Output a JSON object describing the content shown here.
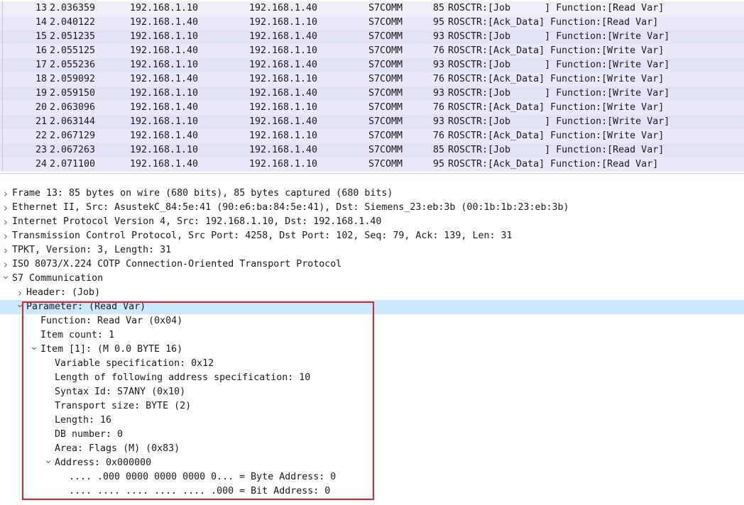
{
  "packet_list": {
    "rows": [
      {
        "no": "13",
        "time": "2.036359",
        "source": "192.168.1.10",
        "destination": "192.168.1.40",
        "protocol": "S7COMM",
        "length": "85",
        "info": "ROSCTR:[Job      ] Function:[Read Var]"
      },
      {
        "no": "14",
        "time": "2.040122",
        "source": "192.168.1.40",
        "destination": "192.168.1.10",
        "protocol": "S7COMM",
        "length": "95",
        "info": "ROSCTR:[Ack_Data] Function:[Read Var]"
      },
      {
        "no": "15",
        "time": "2.051235",
        "source": "192.168.1.10",
        "destination": "192.168.1.40",
        "protocol": "S7COMM",
        "length": "93",
        "info": "ROSCTR:[Job      ] Function:[Write Var]"
      },
      {
        "no": "16",
        "time": "2.055125",
        "source": "192.168.1.40",
        "destination": "192.168.1.10",
        "protocol": "S7COMM",
        "length": "76",
        "info": "ROSCTR:[Ack_Data] Function:[Write Var]"
      },
      {
        "no": "17",
        "time": "2.055236",
        "source": "192.168.1.10",
        "destination": "192.168.1.40",
        "protocol": "S7COMM",
        "length": "93",
        "info": "ROSCTR:[Job      ] Function:[Write Var]"
      },
      {
        "no": "18",
        "time": "2.059092",
        "source": "192.168.1.40",
        "destination": "192.168.1.10",
        "protocol": "S7COMM",
        "length": "76",
        "info": "ROSCTR:[Ack_Data] Function:[Write Var]"
      },
      {
        "no": "19",
        "time": "2.059150",
        "source": "192.168.1.10",
        "destination": "192.168.1.40",
        "protocol": "S7COMM",
        "length": "93",
        "info": "ROSCTR:[Job      ] Function:[Write Var]"
      },
      {
        "no": "20",
        "time": "2.063096",
        "source": "192.168.1.40",
        "destination": "192.168.1.10",
        "protocol": "S7COMM",
        "length": "76",
        "info": "ROSCTR:[Ack_Data] Function:[Write Var]"
      },
      {
        "no": "21",
        "time": "2.063144",
        "source": "192.168.1.10",
        "destination": "192.168.1.40",
        "protocol": "S7COMM",
        "length": "93",
        "info": "ROSCTR:[Job      ] Function:[Write Var]"
      },
      {
        "no": "22",
        "time": "2.067129",
        "source": "192.168.1.40",
        "destination": "192.168.1.10",
        "protocol": "S7COMM",
        "length": "76",
        "info": "ROSCTR:[Ack_Data] Function:[Write Var]"
      },
      {
        "no": "23",
        "time": "2.067263",
        "source": "192.168.1.10",
        "destination": "192.168.1.40",
        "protocol": "S7COMM",
        "length": "85",
        "info": "ROSCTR:[Job      ] Function:[Read Var]"
      },
      {
        "no": "24",
        "time": "2.071100",
        "source": "192.168.1.40",
        "destination": "192.168.1.10",
        "protocol": "S7COMM",
        "length": "95",
        "info": "ROSCTR:[Ack_Data] Function:[Read Var]"
      }
    ]
  },
  "details": {
    "rows": [
      {
        "text": "Frame 13: 85 bytes on wire (680 bits), 85 bytes captured (680 bits)",
        "level": 0,
        "arrow": "collapsed"
      },
      {
        "text": "Ethernet II, Src: AsustekC_84:5e:41 (90:e6:ba:84:5e:41), Dst: Siemens_23:eb:3b (00:1b:1b:23:eb:3b)",
        "level": 0,
        "arrow": "collapsed"
      },
      {
        "text": "Internet Protocol Version 4, Src: 192.168.1.10, Dst: 192.168.1.40",
        "level": 0,
        "arrow": "collapsed"
      },
      {
        "text": "Transmission Control Protocol, Src Port: 4258, Dst Port: 102, Seq: 79, Ack: 139, Len: 31",
        "level": 0,
        "arrow": "collapsed"
      },
      {
        "text": "TPKT, Version: 3, Length: 31",
        "level": 0,
        "arrow": "collapsed"
      },
      {
        "text": "ISO 8073/X.224 COTP Connection-Oriented Transport Protocol",
        "level": 0,
        "arrow": "collapsed"
      },
      {
        "text": "S7 Communication",
        "level": 0,
        "arrow": "expanded"
      },
      {
        "text": "Header: (Job)",
        "level": 1,
        "arrow": "collapsed"
      },
      {
        "text": "Parameter: (Read Var)",
        "level": 1,
        "arrow": "expanded",
        "selected": true
      },
      {
        "text": "Function: Read Var (0x04)",
        "level": 2,
        "arrow": "none"
      },
      {
        "text": "Item count: 1",
        "level": 2,
        "arrow": "none"
      },
      {
        "text": "Item [1]: (M 0.0 BYTE 16)",
        "level": 2,
        "arrow": "expanded"
      },
      {
        "text": "Variable specification: 0x12",
        "level": 3,
        "arrow": "none"
      },
      {
        "text": "Length of following address specification: 10",
        "level": 3,
        "arrow": "none"
      },
      {
        "text": "Syntax Id: S7ANY (0x10)",
        "level": 3,
        "arrow": "none"
      },
      {
        "text": "Transport size: BYTE (2)",
        "level": 3,
        "arrow": "none"
      },
      {
        "text": "Length: 16",
        "level": 3,
        "arrow": "none"
      },
      {
        "text": "DB number: 0",
        "level": 3,
        "arrow": "none"
      },
      {
        "text": "Area: Flags (M) (0x83)",
        "level": 3,
        "arrow": "none"
      },
      {
        "text": "Address: 0x000000",
        "level": 3,
        "arrow": "expanded"
      },
      {
        "text": ".... .000 0000 0000 0000 0... = Byte Address: 0",
        "level": 4,
        "arrow": "none"
      },
      {
        "text": ".... .... .... .... .... .000 = Bit Address: 0",
        "level": 4,
        "arrow": "none"
      }
    ]
  },
  "icons": {
    "collapsed": "chevron-right-icon",
    "expanded": "chevron-down-icon"
  },
  "colors": {
    "row_bg": "#e9e9fb",
    "selected_bg": "#cce8ff",
    "highlight_border": "#e0202a"
  }
}
